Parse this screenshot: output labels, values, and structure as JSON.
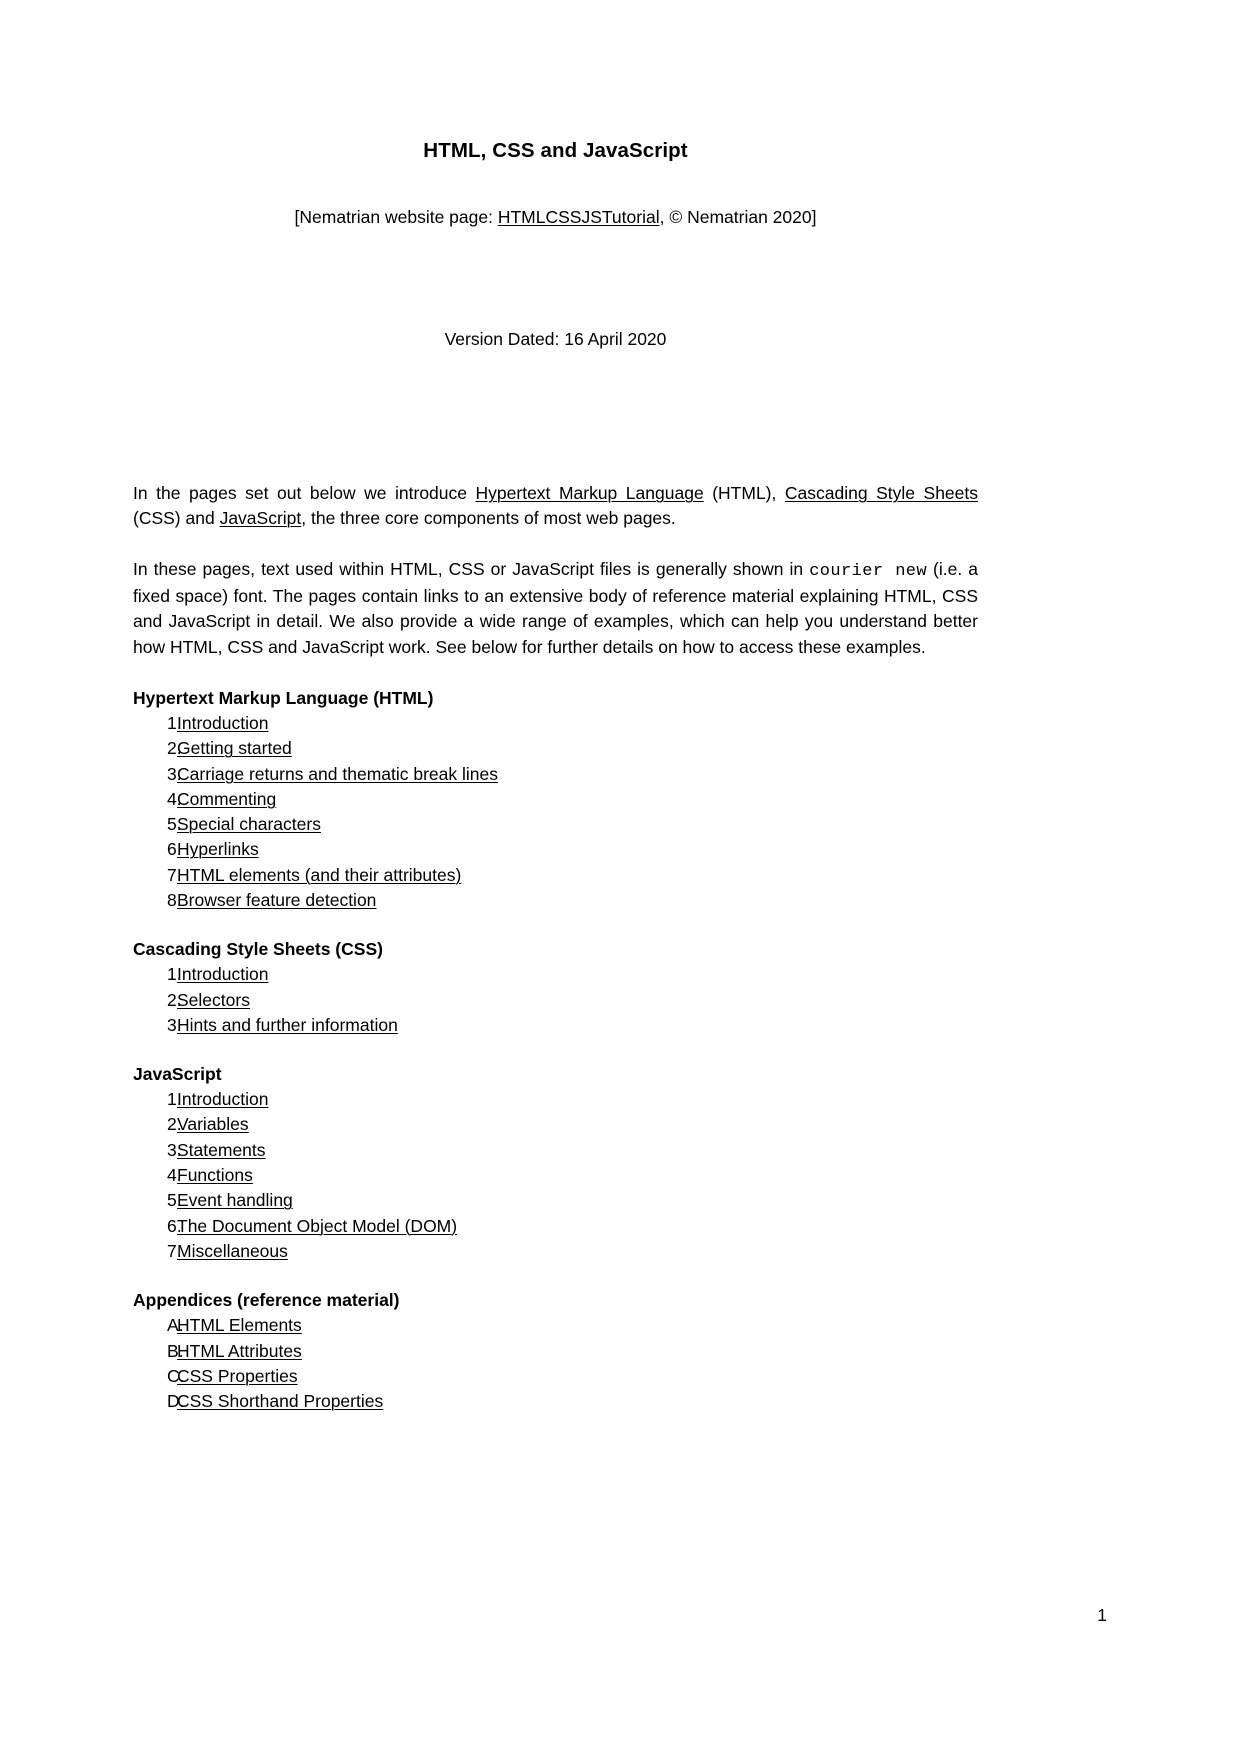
{
  "document": {
    "title": "HTML, CSS and JavaScript",
    "subtitle": {
      "prefix": "[Nematrian website page: ",
      "link": "HTMLCSSJSTutorial",
      "suffix": ", © Nematrian 2020]"
    },
    "version": "Version Dated: 16 April  2020",
    "page_number": "1"
  },
  "paragraphs": {
    "intro": {
      "p1": "In the pages set out below we introduce ",
      "link1": "Hypertext Markup Language",
      "p2": " (HTML), ",
      "link2": "Cascading Style Sheets",
      "p3": " (CSS) and ",
      "link3": "JavaScript",
      "p4": ", the three core components of most web pages."
    },
    "second": {
      "p1": "In these pages, text used within HTML, CSS or JavaScript files is generally shown in ",
      "mono": "courier new",
      "p2": " (i.e. a fixed space) font. The pages contain links to an extensive body of reference material explaining HTML, CSS and JavaScript in detail. We also provide a wide range of examples, which can help you understand better how HTML, CSS and JavaScript work. See below for further details on how to access these examples."
    }
  },
  "sections": [
    {
      "heading": "Hypertext Markup Language (HTML)",
      "items": [
        {
          "marker": "1.",
          "label": "Introduction"
        },
        {
          "marker": "2.",
          "label": "Getting started"
        },
        {
          "marker": "3.",
          "label": "Carriage returns and thematic break lines"
        },
        {
          "marker": "4.",
          "label": "Commenting"
        },
        {
          "marker": "5.",
          "label": "Special characters"
        },
        {
          "marker": "6.",
          "label": "Hyperlinks"
        },
        {
          "marker": "7.",
          "label": "HTML elements (and their attributes)"
        },
        {
          "marker": "8.",
          "label": "Browser feature detection"
        }
      ]
    },
    {
      "heading": "Cascading Style Sheets (CSS)",
      "items": [
        {
          "marker": "1.",
          "label": "Introduction"
        },
        {
          "marker": "2.",
          "label": "Selectors"
        },
        {
          "marker": "3.",
          "label": "Hints and further information"
        }
      ]
    },
    {
      "heading": "JavaScript",
      "items": [
        {
          "marker": "1.",
          "label": "Introduction"
        },
        {
          "marker": "2.",
          "label": "Variables"
        },
        {
          "marker": "3.",
          "label": "Statements"
        },
        {
          "marker": "4.",
          "label": "Functions"
        },
        {
          "marker": "5.",
          "label": "Event handling"
        },
        {
          "marker": "6.",
          "label": "The Document Object Model (DOM)"
        },
        {
          "marker": "7.",
          "label": "Miscellaneous"
        }
      ]
    },
    {
      "heading": "Appendices (reference material)",
      "items": [
        {
          "marker": "A.",
          "label": "HTML Elements"
        },
        {
          "marker": "B.",
          "label": "HTML Attributes"
        },
        {
          "marker": "C.",
          "label": "CSS Properties"
        },
        {
          "marker": "D.",
          "label": "CSS Shorthand Properties"
        }
      ]
    }
  ]
}
